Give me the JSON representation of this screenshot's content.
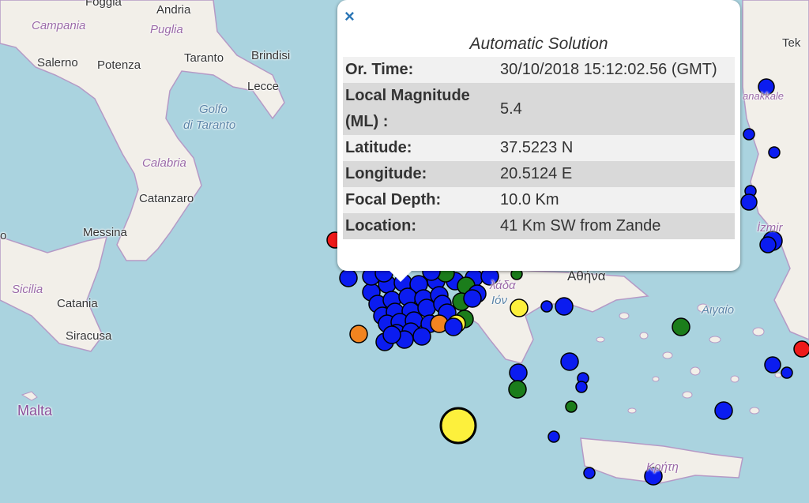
{
  "map": {
    "places": [
      {
        "id": "foggia",
        "text": "Foggia"
      },
      {
        "id": "andria",
        "text": "Andria"
      },
      {
        "id": "campania",
        "text": "Campania"
      },
      {
        "id": "puglia",
        "text": "Puglia"
      },
      {
        "id": "salerno",
        "text": "Salerno"
      },
      {
        "id": "potenza",
        "text": "Potenza"
      },
      {
        "id": "taranto",
        "text": "Taranto"
      },
      {
        "id": "brindisi",
        "text": "Brindisi"
      },
      {
        "id": "lecce",
        "text": "Lecce"
      },
      {
        "id": "golfo",
        "text": "Golfo"
      },
      {
        "id": "ditaranto",
        "text": "di Taranto"
      },
      {
        "id": "calabria",
        "text": "Calabria"
      },
      {
        "id": "catanzaro",
        "text": "Catanzaro"
      },
      {
        "id": "messina",
        "text": "Messina"
      },
      {
        "id": "sicilia",
        "text": "Sicilia"
      },
      {
        "id": "catania",
        "text": "Catania"
      },
      {
        "id": "siracusa",
        "text": "Siracusa"
      },
      {
        "id": "malta",
        "text": "Malta"
      },
      {
        "id": "o",
        "text": "o"
      },
      {
        "id": "tek",
        "text": "Tek"
      },
      {
        "id": "canakkale",
        "text": "anakkale"
      },
      {
        "id": "izmir",
        "text": "İzmir"
      },
      {
        "id": "athina",
        "text": "Αθήνα"
      },
      {
        "id": "aigaio",
        "text": "Αιγαίο"
      },
      {
        "id": "kriti",
        "text": "Κρήτη"
      },
      {
        "id": "ellada",
        "text": "λάδα"
      },
      {
        "id": "ionio",
        "text": "Ιόν"
      }
    ],
    "colors": {
      "sea": "#aad3df",
      "land": "#f2efe9",
      "border": "#b59ac6",
      "marker_blue": "#0b1cf0",
      "marker_green": "#1b7d1b",
      "marker_yellow": "#fdf03c",
      "marker_orange": "#f28420",
      "marker_red": "#ee1a1a"
    }
  },
  "popup": {
    "close_label": "×",
    "title": "Automatic Solution",
    "rows": [
      {
        "label": "Or. Time:",
        "value": "30/10/2018 15:12:02.56 (GMT)"
      },
      {
        "label": "Local Magnitude (ML) :",
        "value": "5.4"
      },
      {
        "label": "Latitude:",
        "value": "37.5223 N"
      },
      {
        "label": "Longitude:",
        "value": "20.5124 E"
      },
      {
        "label": "Focal Depth:",
        "value": "10.0 Km"
      },
      {
        "label": "Location:",
        "value": "41 Km SW from Zande"
      }
    ]
  }
}
